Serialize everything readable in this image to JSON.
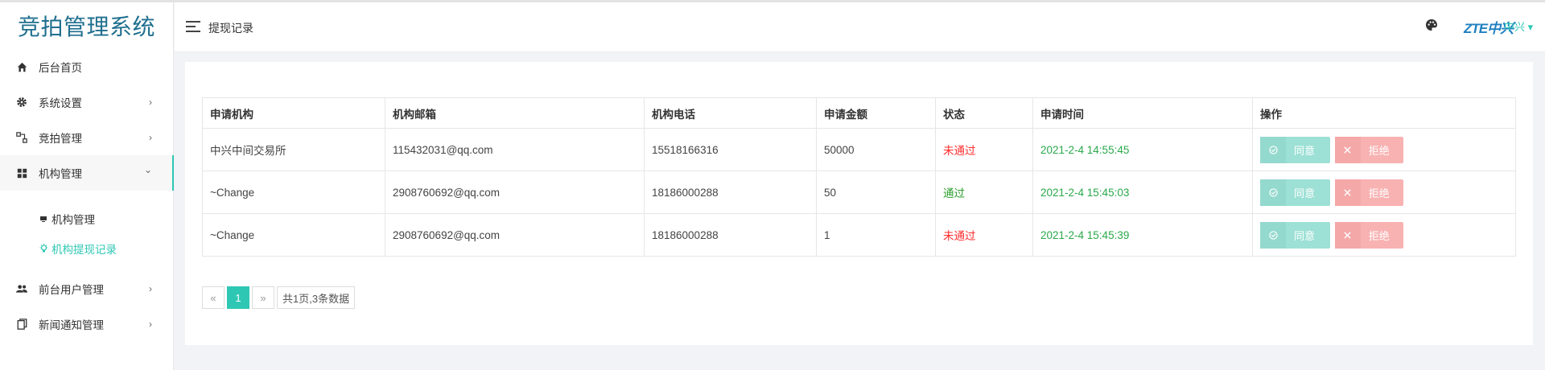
{
  "app": {
    "title": "竞拍管理系统"
  },
  "header": {
    "page_title": "提现记录",
    "logo_text": "ZTE中兴",
    "user_label": "中兴 ▾"
  },
  "sidebar": {
    "items": [
      {
        "label": "后台首页",
        "icon": "home-icon",
        "has_arrow": false
      },
      {
        "label": "系统设置",
        "icon": "gear-icon",
        "has_arrow": true
      },
      {
        "label": "竞拍管理",
        "icon": "auction-icon",
        "has_arrow": true
      },
      {
        "label": "机构管理",
        "icon": "grid-icon",
        "has_arrow": true,
        "open": true
      },
      {
        "label": "前台用户管理",
        "icon": "users-icon",
        "has_arrow": true
      },
      {
        "label": "新闻通知管理",
        "icon": "copy-icon",
        "has_arrow": true
      }
    ],
    "sub_items": [
      {
        "label": "机构管理",
        "icon": "monitor-icon",
        "active": false
      },
      {
        "label": "机构提现记录",
        "icon": "bulb-icon",
        "active": true
      }
    ],
    "arrow_right": "›",
    "arrow_down": "⌄"
  },
  "table": {
    "headers": [
      "申请机构",
      "机构邮箱",
      "机构电话",
      "申请金额",
      "状态",
      "申请时间",
      "操作"
    ],
    "rows": [
      {
        "org": "中兴中间交易所",
        "email": "115432031@qq.com",
        "phone": "15518166316",
        "amount": "50000",
        "status": "未通过",
        "status_type": "fail",
        "time": "2021-2-4 14:55:45"
      },
      {
        "org": "~Change",
        "email": "2908760692@qq.com",
        "phone": "18186000288",
        "amount": "50",
        "status": "通过",
        "status_type": "pass",
        "time": "2021-2-4 15:45:03"
      },
      {
        "org": "~Change",
        "email": "2908760692@qq.com",
        "phone": "18186000288",
        "amount": "1",
        "status": "未通过",
        "status_type": "fail",
        "time": "2021-2-4 15:45:39"
      }
    ],
    "agree_label": "同意",
    "reject_label": "拒绝"
  },
  "pagination": {
    "prev": "«",
    "current": "1",
    "next": "»",
    "info": "共1页,3条数据"
  },
  "colors": {
    "accent": "#2ec7b4",
    "brand": "#1f6f8f",
    "fail": "#ff2a2a",
    "pass": "#2a9e2a",
    "time": "#2aa84a"
  }
}
